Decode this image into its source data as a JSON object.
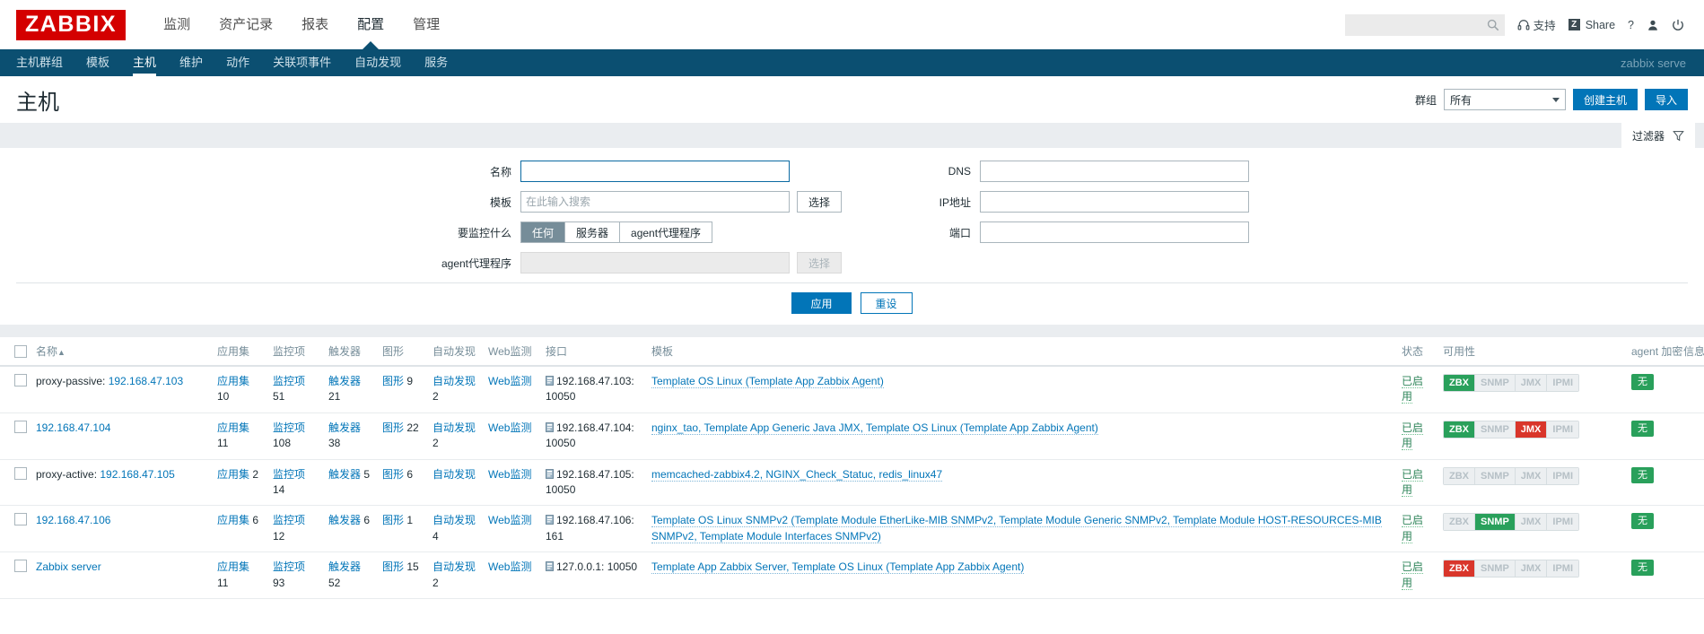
{
  "brand": {
    "logo": "ZABBIX"
  },
  "topnav": {
    "items": [
      {
        "label": "监测",
        "selected": false
      },
      {
        "label": "资产记录",
        "selected": false
      },
      {
        "label": "报表",
        "selected": false
      },
      {
        "label": "配置",
        "selected": true
      },
      {
        "label": "管理",
        "selected": false
      }
    ],
    "search_placeholder": "",
    "search_value": "",
    "support_label": "支持",
    "share_label": "Share",
    "share_badge": "Z",
    "help_label": "?",
    "user_icon": "user-icon",
    "signout_icon": "power-icon"
  },
  "subnav": {
    "items": [
      {
        "label": "主机群组",
        "selected": false
      },
      {
        "label": "模板",
        "selected": false
      },
      {
        "label": "主机",
        "selected": true
      },
      {
        "label": "维护",
        "selected": false
      },
      {
        "label": "动作",
        "selected": false
      },
      {
        "label": "关联项事件",
        "selected": false
      },
      {
        "label": "自动发现",
        "selected": false
      },
      {
        "label": "服务",
        "selected": false
      }
    ],
    "server_name": "zabbix serve"
  },
  "page": {
    "title": "主机",
    "group_label": "群组",
    "group_value": "所有",
    "create_host_label": "创建主机",
    "import_label": "导入",
    "filter_tab_label": "过滤器"
  },
  "filter": {
    "name_label": "名称",
    "name_value": "",
    "template_label": "模板",
    "template_placeholder": "在此输入搜索",
    "template_select_label": "选择",
    "monitored_by_label": "要监控什么",
    "monitored_by_options": [
      "任何",
      "服务器",
      "agent代理程序"
    ],
    "monitored_by_selected": "任何",
    "proxy_label": "agent代理程序",
    "proxy_value": "",
    "proxy_select_label": "选择",
    "dns_label": "DNS",
    "dns_value": "",
    "ip_label": "IP地址",
    "ip_value": "",
    "port_label": "端口",
    "port_value": "",
    "apply_label": "应用",
    "reset_label": "重设"
  },
  "table": {
    "headers": [
      "名称",
      "应用集",
      "监控项",
      "触发器",
      "图形",
      "自动发现",
      "Web监测",
      "接口",
      "模板",
      "状态",
      "可用性",
      "agent 加密",
      "信息"
    ],
    "sort_indicator": "▲",
    "rows": [
      {
        "name_prefix": "proxy-passive: ",
        "name": "192.168.47.103",
        "name_is_link": true,
        "applications": "应用集",
        "applications_count": "10",
        "items": "监控项",
        "items_count": "51",
        "triggers": "触发器",
        "triggers_count": "21",
        "graphs": "图形",
        "graphs_count": "9",
        "discovery": "自动发现",
        "discovery_count": "2",
        "web": "Web监测",
        "interface": "192.168.47.103: 10050",
        "templates": "Template OS Linux (Template App Zabbix Agent)",
        "status": "已启用",
        "availability": [
          {
            "label": "ZBX",
            "state": "ok"
          },
          {
            "label": "SNMP",
            "state": "off"
          },
          {
            "label": "JMX",
            "state": "off"
          },
          {
            "label": "IPMI",
            "state": "off"
          }
        ],
        "encryption": "无",
        "info": ""
      },
      {
        "name_prefix": "",
        "name": "192.168.47.104",
        "name_is_link": true,
        "applications": "应用集",
        "applications_count": "11",
        "items": "监控项",
        "items_count": "108",
        "triggers": "触发器",
        "triggers_count": "38",
        "graphs": "图形",
        "graphs_count": "22",
        "discovery": "自动发现",
        "discovery_count": "2",
        "web": "Web监测",
        "interface": "192.168.47.104: 10050",
        "templates": "nginx_tao, Template App Generic Java JMX, Template OS Linux (Template App Zabbix Agent)",
        "status": "已启用",
        "availability": [
          {
            "label": "ZBX",
            "state": "ok"
          },
          {
            "label": "SNMP",
            "state": "off"
          },
          {
            "label": "JMX",
            "state": "bad"
          },
          {
            "label": "IPMI",
            "state": "off"
          }
        ],
        "encryption": "无",
        "info": ""
      },
      {
        "name_prefix": "proxy-active: ",
        "name": "192.168.47.105",
        "name_is_link": true,
        "applications": "应用集",
        "applications_count": "2",
        "items": "监控项",
        "items_count": "14",
        "triggers": "触发器",
        "triggers_count": "5",
        "graphs": "图形",
        "graphs_count": "6",
        "discovery": "自动发现",
        "discovery_count": "",
        "web": "Web监测",
        "interface": "192.168.47.105: 10050",
        "templates": "memcached-zabbix4.2, NGINX_Check_Statuc, redis_linux47",
        "status": "已启用",
        "availability": [
          {
            "label": "ZBX",
            "state": "off"
          },
          {
            "label": "SNMP",
            "state": "off"
          },
          {
            "label": "JMX",
            "state": "off"
          },
          {
            "label": "IPMI",
            "state": "off"
          }
        ],
        "encryption": "无",
        "info": ""
      },
      {
        "name_prefix": "",
        "name": "192.168.47.106",
        "name_is_link": true,
        "applications": "应用集",
        "applications_count": "6",
        "items": "监控项",
        "items_count": "12",
        "triggers": "触发器",
        "triggers_count": "6",
        "graphs": "图形",
        "graphs_count": "1",
        "discovery": "自动发现",
        "discovery_count": "4",
        "web": "Web监测",
        "interface": "192.168.47.106: 161",
        "templates": "Template OS Linux SNMPv2 (Template Module EtherLike-MIB SNMPv2, Template Module Generic SNMPv2, Template Module HOST-RESOURCES-MIB SNMPv2, Template Module Interfaces SNMPv2)",
        "status": "已启用",
        "availability": [
          {
            "label": "ZBX",
            "state": "off"
          },
          {
            "label": "SNMP",
            "state": "ok"
          },
          {
            "label": "JMX",
            "state": "off"
          },
          {
            "label": "IPMI",
            "state": "off"
          }
        ],
        "encryption": "无",
        "info": ""
      },
      {
        "name_prefix": "",
        "name": "Zabbix server",
        "name_is_link": true,
        "applications": "应用集",
        "applications_count": "11",
        "items": "监控项",
        "items_count": "93",
        "triggers": "触发器",
        "triggers_count": "52",
        "graphs": "图形",
        "graphs_count": "15",
        "discovery": "自动发现",
        "discovery_count": "2",
        "web": "Web监测",
        "interface": "127.0.0.1: 10050",
        "templates": "Template App Zabbix Server, Template OS Linux (Template App Zabbix Agent)",
        "status": "已启用",
        "availability": [
          {
            "label": "ZBX",
            "state": "bad"
          },
          {
            "label": "SNMP",
            "state": "off"
          },
          {
            "label": "JMX",
            "state": "off"
          },
          {
            "label": "IPMI",
            "state": "off"
          }
        ],
        "encryption": "无",
        "info": ""
      }
    ]
  },
  "colors": {
    "brand_red": "#d40000",
    "nav_blue": "#0b4f71",
    "link_blue": "#0275b8",
    "ok_green": "#29a05b",
    "bad_red": "#d9362b"
  }
}
